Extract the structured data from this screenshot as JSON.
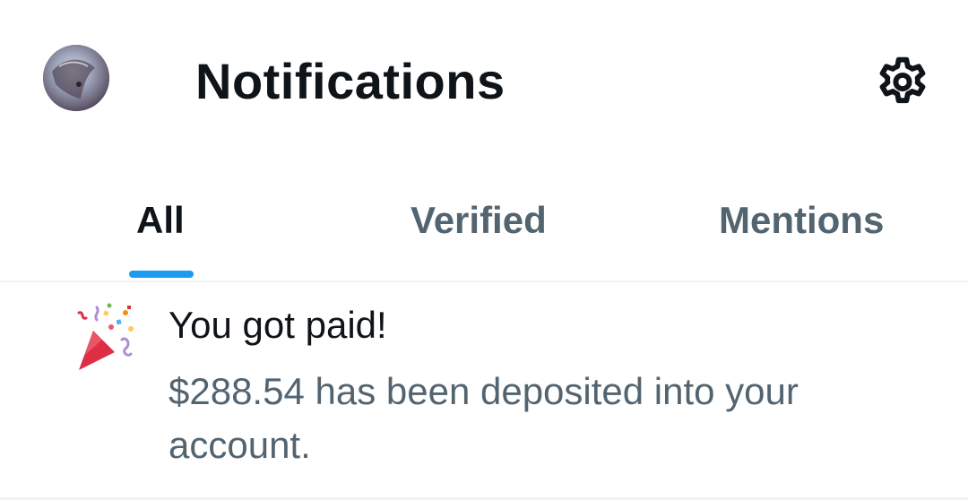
{
  "header": {
    "title": "Notifications"
  },
  "tabs": [
    {
      "label": "All",
      "active": true
    },
    {
      "label": "Verified",
      "active": false
    },
    {
      "label": "Mentions",
      "active": false
    }
  ],
  "notifications": [
    {
      "title": "You got paid!",
      "body": "$288.54 has been deposited into your account.",
      "icon": "party-popper-icon"
    }
  ],
  "colors": {
    "accent": "#1d9bf0",
    "text_primary": "#0f1419",
    "text_secondary": "#536471",
    "divider": "#eff3f4"
  }
}
